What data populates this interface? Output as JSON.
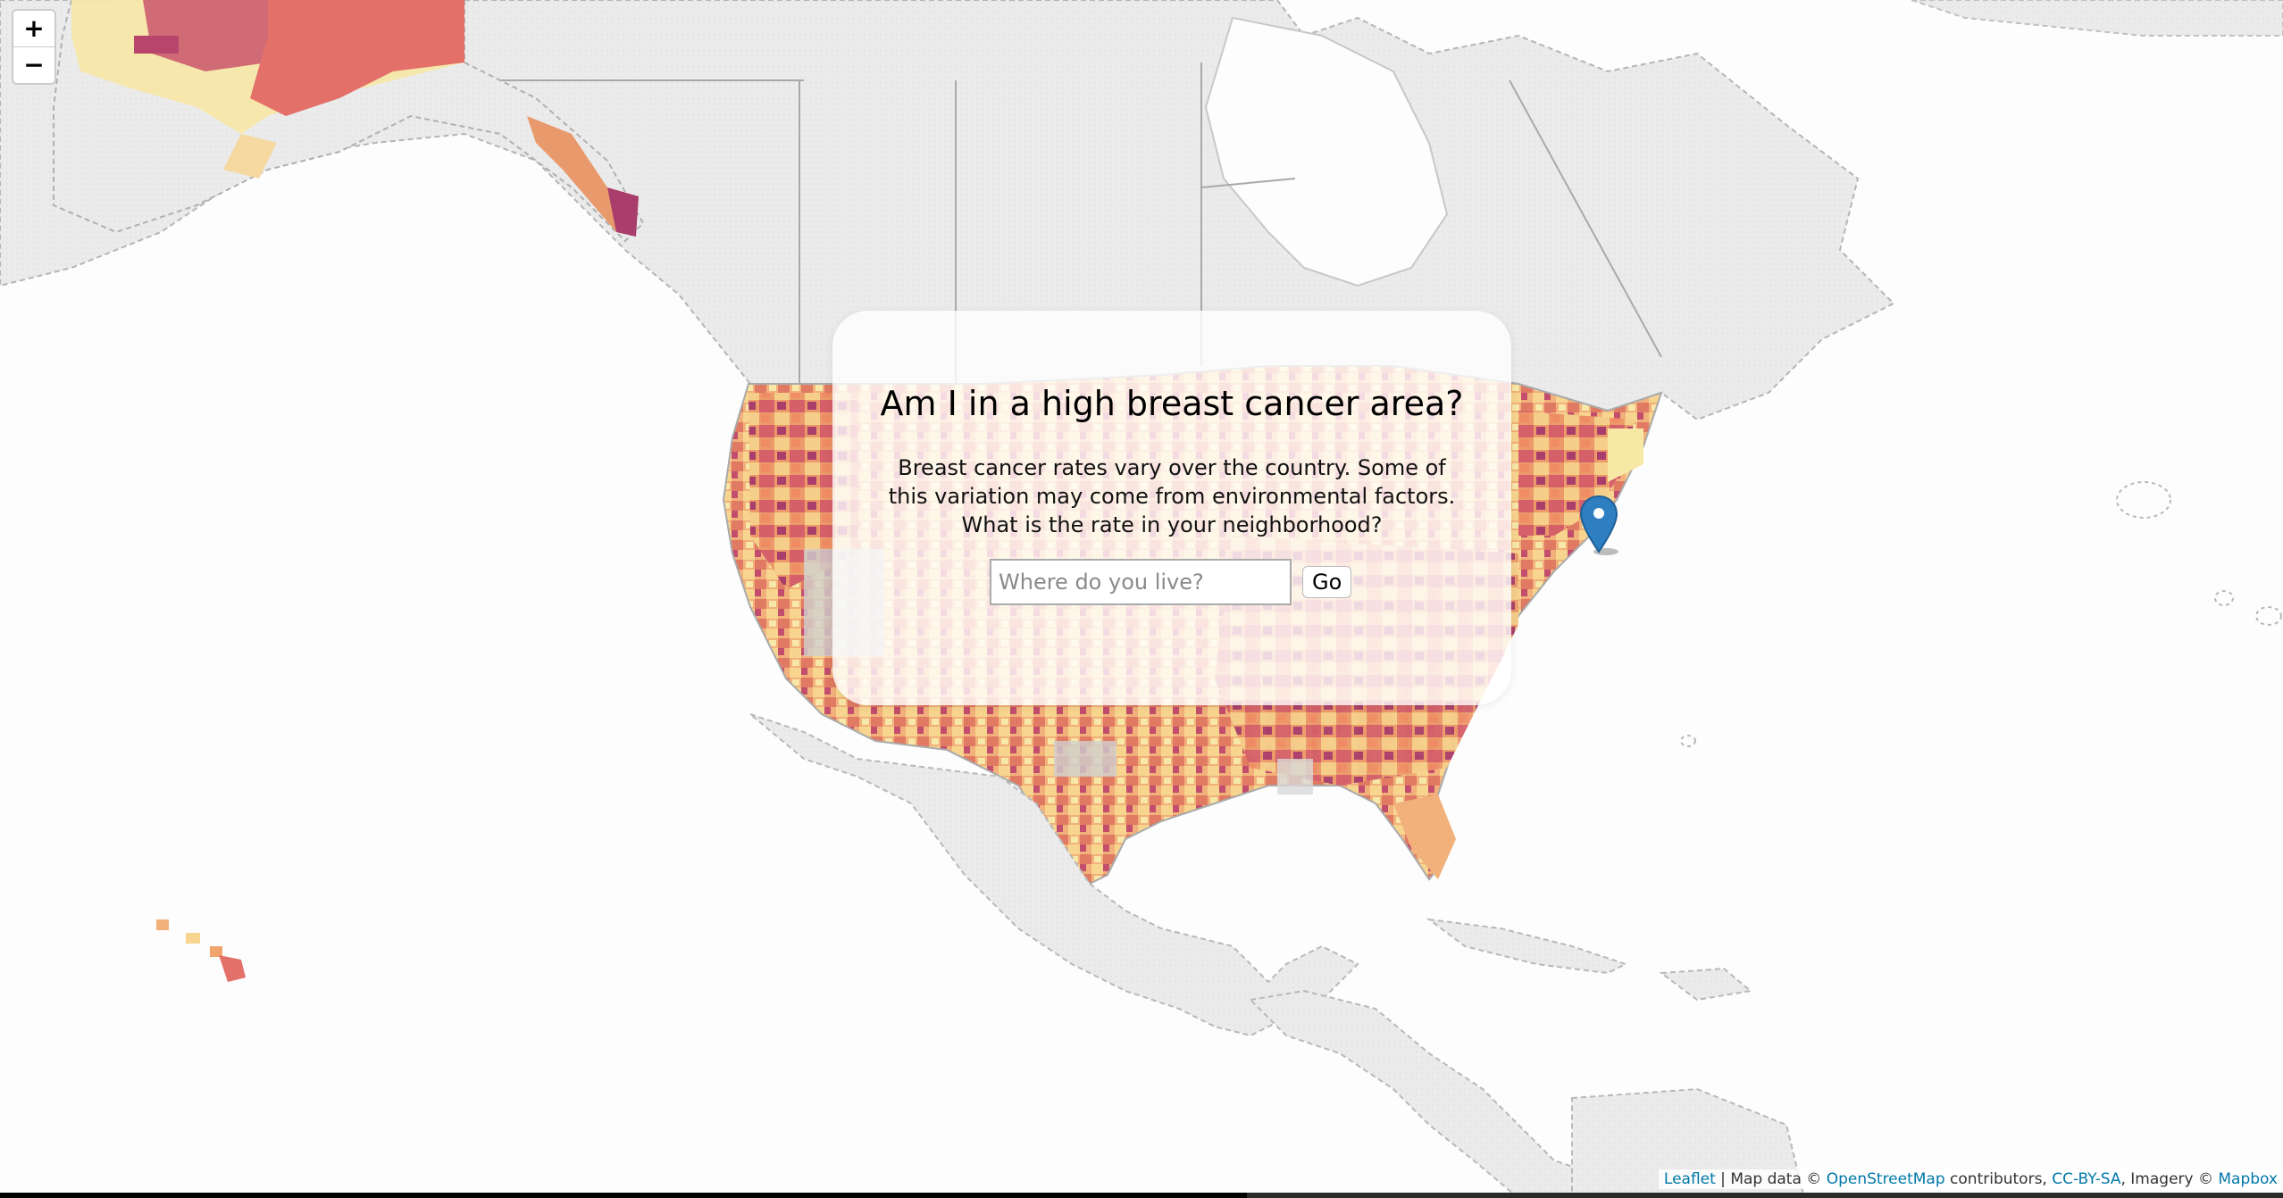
{
  "map": {
    "zoom_in_label": "+",
    "zoom_out_label": "−",
    "marker_icon": "map-pin-icon",
    "colors": {
      "land": "#ececec",
      "water": "#fdfdfd",
      "border": "#9a9a9a",
      "choropleth_low": "#f7e8a6",
      "choropleth_mid": "#f0a56d",
      "choropleth_high": "#e06a5e",
      "choropleth_top": "#b8456c",
      "no_data": "#cfcfcf",
      "marker": "#2e7fc2"
    }
  },
  "panel": {
    "title": "Am I in a high breast cancer area?",
    "description": "Breast cancer rates vary over the country. Some of this variation may come from environmental factors. What is the rate in your neighborhood?",
    "search_placeholder": "Where do you live?",
    "search_value": "",
    "go_label": "Go"
  },
  "attribution": {
    "leaflet": "Leaflet",
    "sep": " | Map data © ",
    "osm": "OpenStreetMap",
    "contributors": " contributors, ",
    "license": "CC-BY-SA",
    "imagery": ", Imagery © ",
    "mapbox": "Mapbox"
  }
}
